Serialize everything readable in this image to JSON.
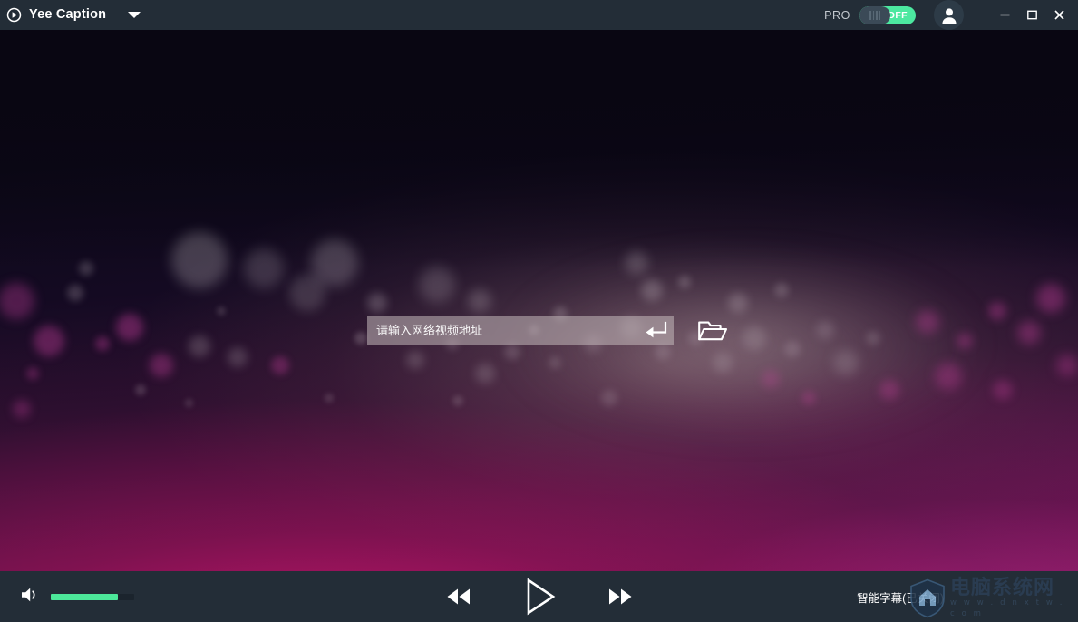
{
  "app": {
    "title": "Yee Caption",
    "logo_icon": "play-circle-icon",
    "menu_caret_icon": "chevron-down-icon"
  },
  "titlebar": {
    "pro_label": "PRO",
    "pro_toggle_state": "OFF",
    "avatar_icon": "user-avatar-icon",
    "window_controls": [
      {
        "name": "minimize",
        "icon": "minimize-icon"
      },
      {
        "name": "maximize",
        "icon": "maximize-icon"
      },
      {
        "name": "close",
        "icon": "close-icon"
      }
    ]
  },
  "stage": {
    "url_input": {
      "value": "",
      "placeholder": "请输入网络视频地址"
    },
    "enter_button_icon": "enter-return-icon",
    "open_folder_icon": "folder-open-icon"
  },
  "bottombar": {
    "volume_icon": "speaker-volume-icon",
    "volume_percent": 80,
    "controls": [
      {
        "name": "rewind",
        "icon": "rewind-icon"
      },
      {
        "name": "play",
        "icon": "play-icon"
      },
      {
        "name": "fast-forward",
        "icon": "fast-forward-icon"
      }
    ],
    "subtitle_status": "智能字幕(已关闭)"
  },
  "watermark": {
    "name_cn": "电脑系统网",
    "url": "w w w . d n x t w . c o m"
  },
  "colors": {
    "chrome": "#232d37",
    "accent_green": "#4ce89a",
    "text_primary": "#ffffff",
    "bg_top": "#090612",
    "bg_magenta": "#7c1653"
  }
}
